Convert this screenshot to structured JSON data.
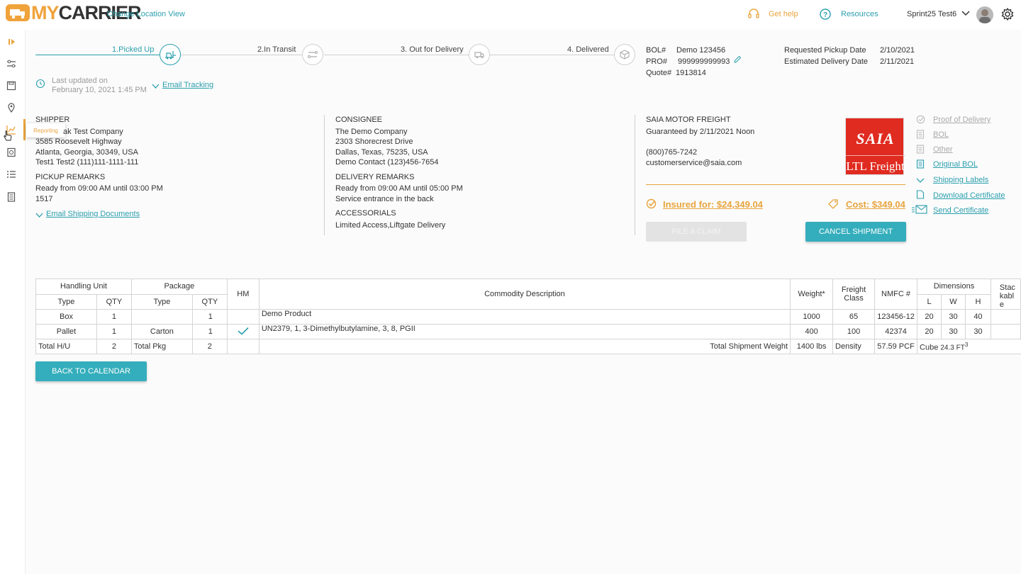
{
  "header": {
    "logo_my": "MY",
    "logo_carrier": "CARRIER",
    "change_location": "Change Location View",
    "get_help": "Get help",
    "resources": "Resources",
    "user_name": "Sprint25 Test6"
  },
  "sidebar": {
    "tooltip": "Reporting"
  },
  "progress": {
    "steps": [
      {
        "label": "1.Picked Up"
      },
      {
        "label": "2.In Transit"
      },
      {
        "label": "3. Out for Delivery"
      },
      {
        "label": "4. Delivered"
      }
    ],
    "last_updated_label": "Last updated on",
    "last_updated_value": "February 10, 2021 1:45 PM",
    "email_tracking": "Email Tracking"
  },
  "shipment_ids": {
    "bol_label": "BOL#",
    "bol_value": "Demo 123456",
    "pro_label": "PRO#",
    "pro_value": "999999999993",
    "quote_label": "Quote#",
    "quote_value": "1913814",
    "requested_pickup_label": "Requested Pickup Date",
    "requested_pickup_value": "2/10/2021",
    "estimated_delivery_label": "Estimated Delivery Date",
    "estimated_delivery_value": "2/11/2021"
  },
  "shipper": {
    "title": "SHIPPER",
    "company": "ak Test Company",
    "address1": "3585 Roosevelt Highway",
    "address2": "Atlanta, Georgia, 30349, USA",
    "contact": "Test1 Test2 (111)111-1111-111",
    "remarks_title": "PICKUP REMARKS",
    "remarks1": "Ready from 09:00 AM until 03:00 PM",
    "remarks2": "1517",
    "email_docs": "Email Shipping Documents"
  },
  "consignee": {
    "title": "CONSIGNEE",
    "company": "The Demo Company",
    "address1": "2303 Shorecrest Drive",
    "address2": "Dallas, Texas, 75235, USA",
    "contact": "Demo Contact (123)456-7654",
    "remarks_title": "DELIVERY REMARKS",
    "remarks1": "Ready from 09:00 AM until 05:00 PM",
    "remarks2": "Service entrance in the back",
    "accessorials_title": "ACCESSORIALS",
    "accessorials": "Limited Access,Liftgate Delivery"
  },
  "carrier": {
    "name": "SAIA MOTOR FREIGHT",
    "guarantee": "Guaranteed by 2/11/2021 Noon",
    "phone": "(800)765-7242",
    "email": "customerservice@saia.com",
    "logo_top": "SAIA",
    "logo_bottom": "LTL Freight",
    "insured": "Insured for: $24,349.04",
    "cost": "Cost: $349.04",
    "file_claim": "FILE A CLAIM",
    "cancel_shipment": "CANCEL SHIPMENT"
  },
  "documents": [
    {
      "label": "Proof of Delivery",
      "icon": "check-circle-icon",
      "enabled": false
    },
    {
      "label": "BOL",
      "icon": "document-icon",
      "enabled": false
    },
    {
      "label": "Other",
      "icon": "document-icon",
      "enabled": false
    },
    {
      "label": "Original BOL",
      "icon": "document-icon",
      "enabled": true
    },
    {
      "label": "Shipping Labels",
      "icon": "chevron-down-icon",
      "enabled": true
    },
    {
      "label": "Download Certificate",
      "icon": "document-icon",
      "enabled": true
    },
    {
      "label": "Send Certificate",
      "icon": "envelope-icon",
      "enabled": true
    }
  ],
  "table": {
    "group_headers": {
      "handling_unit": "Handling Unit",
      "package": "Package",
      "hm": "HM",
      "commodity": "Commodity Description",
      "weight": "Weight*",
      "freight_class": "Freight Class",
      "nmfc": "NMFC #",
      "dimensions": "Dimensions",
      "stackable": "Stackable"
    },
    "sub_headers": {
      "type": "Type",
      "qty": "QTY",
      "l": "L",
      "w": "W",
      "h": "H"
    },
    "rows": [
      {
        "hu_type": "Box",
        "hu_qty": "1",
        "pkg_type": "",
        "pkg_qty": "1",
        "hm": false,
        "description": "Demo Product",
        "weight": "1000",
        "class": "65",
        "nmfc": "123456-12",
        "l": "20",
        "w": "30",
        "h": "40"
      },
      {
        "hu_type": "Pallet",
        "hu_qty": "1",
        "pkg_type": "Carton",
        "pkg_qty": "1",
        "hm": true,
        "description": "UN2379, 1, 3-Dimethylbutylamine, 3, 8, PGII",
        "weight": "400",
        "class": "100",
        "nmfc": "42374",
        "l": "20",
        "w": "30",
        "h": "30"
      }
    ],
    "totals": {
      "total_hu_label": "Total H/U",
      "total_hu": "2",
      "total_pkg_label": "Total Pkg",
      "total_pkg": "2",
      "total_weight_label": "Total Shipment Weight",
      "total_weight": "1400 lbs",
      "density_label": "Density",
      "density": "57.59 PCF",
      "cube_label": "Cube",
      "cube": "24.3 FT",
      "cube_sup": "3"
    }
  },
  "back_button": "BACK TO CALENDAR"
}
